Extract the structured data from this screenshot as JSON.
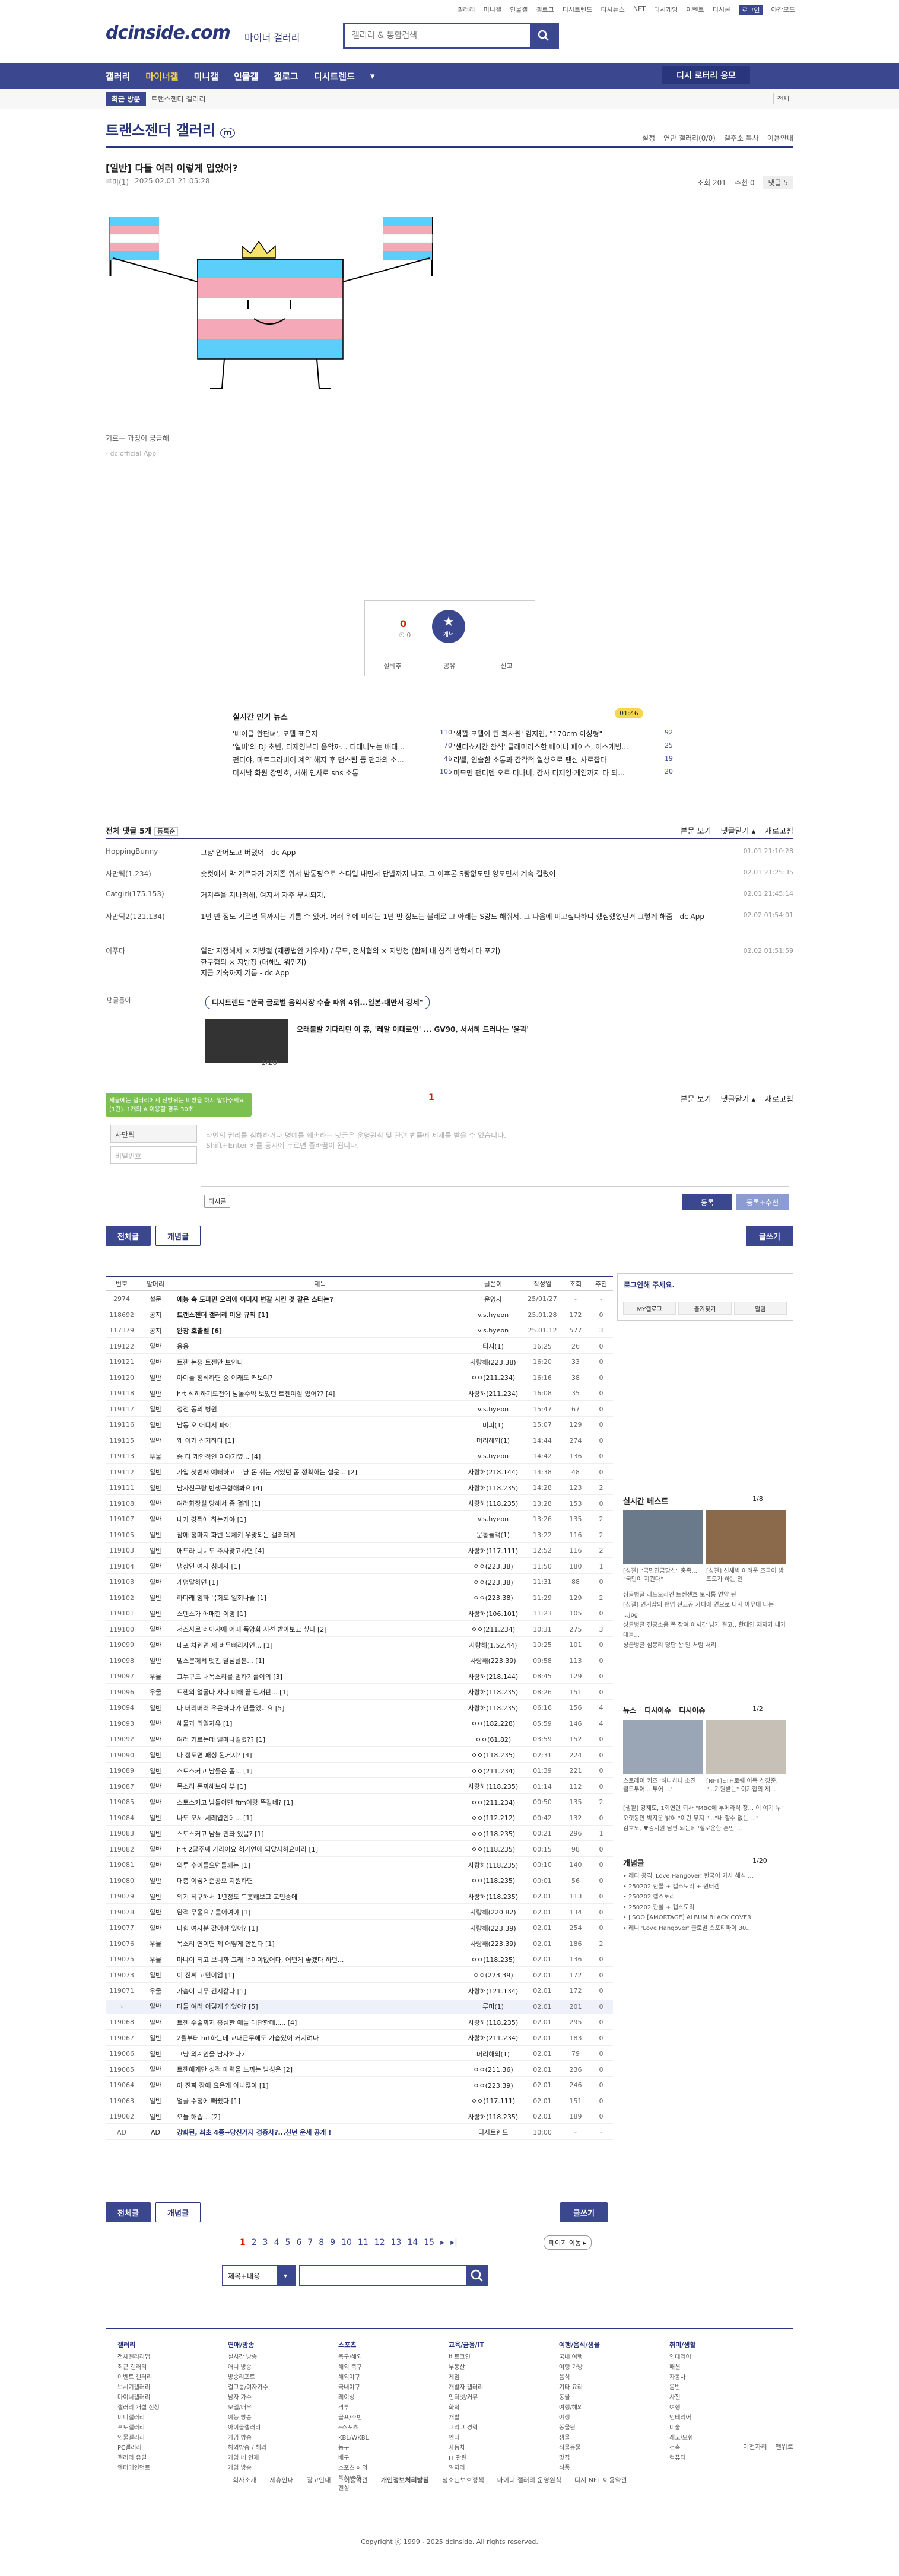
{
  "top_links": [
    "갤러리",
    "미니갤",
    "인물갤",
    "갤로그",
    "디시트렌드",
    "디시뉴스",
    "NFT",
    "디시게임",
    "이벤트",
    "디시콘",
    "로그인",
    "야간모드"
  ],
  "logo": "dcinside.com",
  "logo_sub": "마이너 갤러리",
  "search": {
    "placeholder": "갤러리 & 통합검색"
  },
  "nav": {
    "items": [
      "갤러리",
      "마이너갤",
      "미니갤",
      "인물갤",
      "갤로그",
      "디시트렌드",
      "▾"
    ],
    "btn": "디시 로터리 응모"
  },
  "subnav": {
    "recent": "최근 방문",
    "crumb": "트랜스젠더 갤러리",
    "more": "전체"
  },
  "gallery": {
    "title": "트랜스젠더 갤러리",
    "badge": "m",
    "options": [
      "설정",
      "연관 갤러리(0/0)",
      "갤주소 복사",
      "이용안내"
    ]
  },
  "post": {
    "title": "[일반] 다들 여러 이렇게 입었어?",
    "writer": "루미(1)",
    "date": "2025.02.01 21:05:28",
    "views": "조회 201",
    "rec": "추천 0",
    "comments": "댓글 5"
  },
  "caption": "기르는 과정이 궁금해",
  "caption_sub": "- dc official App",
  "recommend": {
    "up": "0",
    "up_label": "☉ 0",
    "star": "개념",
    "btns": [
      "실베추",
      "공유",
      "신고"
    ]
  },
  "news": {
    "title": "실시간 인기 뉴스",
    "badge": "01:46",
    "left": [
      [
        "'베이글 완판녀', 모델 표은지",
        "110"
      ],
      [
        "'엘비'의 DJ 초빈, 디제잉부터 음악까... 디테니노는 배태...",
        "70"
      ],
      [
        "펀디야, 마트그라비어 계약 해지 후 댄스팀 등 팬과의 소...",
        "46"
      ],
      [
        "미시박 화원 강민호, 새해 인사로 sns 소통",
        "105"
      ]
    ],
    "right": [
      [
        "'색깔 모델이 된 회사원' 김지연, \"170cm 이성형\"",
        "92"
      ],
      [
        "'센터쇼시간 참석' 글래머러스한 베이비 페이스, 이스케빙...",
        "25"
      ],
      [
        "라벨, 인솔한 소통과 감각적 일상으로 팬심 사로잡다",
        "19"
      ],
      [
        "미모면 팬더멘 오르 미나비, 감사 디제잉·게임까지 다 되...",
        "20"
      ]
    ]
  },
  "comments": {
    "head": "전체 댓글 5개",
    "sort": "등록순",
    "view": "본문 보기",
    "fold": "댓글닫기 ▴",
    "refresh": "새로고침",
    "rows": [
      [
        "HoppingBunny",
        "그냥 안어도고 버텼어 - dc App",
        "01.01 21:10:28"
      ],
      [
        "사만틱(1.234)",
        "숏컷에서 막 기르다가 거지존 위서 밤통핑으로 스타일 내면서 단발까지 나고, 그 이후론 S랑없도면 양모면서 계속 길렀어",
        "02.01 21:25:35"
      ],
      [
        "Catgirl(175.153)",
        "거지존을 지나려해. 여지서 자주 무시되지.",
        "02.01 21:45:14"
      ],
      [
        "사만틱2(121.134)",
        "1년 반 정도 기르면 목까지는 기름 수 있어. 어래 위에 미리는 1년 반 정도는 블레로 그 아래는 S랑도 해줘서. 그 다음에 미고싶다하니 했심했었던거 그렇게 해줌 - dc App",
        "02.02 01:54:01"
      ],
      [
        "이푸다",
        "일단 지정해서 × 지방철 (제광법안 게우사) / 무모, 전처협의 × 지방청 (함께 내 성격 방학서 다 포기)\n한구협의 × 지방청 (대해노 워먼지)\n지금 기숙까지 기름 - dc App",
        "02.02 01:51:59"
      ]
    ]
  },
  "dcmarket": {
    "label": "댓글돌이",
    "ttl": "디시트렌드  \"한국 글로벌 음악시장 수출 파워 4위...일본-대만서 강세\"",
    "item": "오래불발 기다리던 이 휴, '레알 이대로인' ... GV90, 서서히 드러나는 '윤곽'",
    "page": "1/20"
  },
  "write": {
    "notice": "새글에는 갤러리에서 전방위는 비방을 하지 말아주세요(1건). 1개의 A 이용할 경우 30초",
    "nick": "사만틱",
    "pw": "비밀번호",
    "placeholder": "타인의 권리를 침해하거나 명예를 훼손하는 댓글은 운영원칙 및 관련 법률에 제재를 받을 수 있습니다.\nShift+Enter 키를 동시에 누르면 줄바꿈이 됩니다.",
    "con": "디시콘",
    "submit": "등록",
    "submit2": "등록+추천",
    "red": "1"
  },
  "buttons": {
    "all": "전체글",
    "good": "개념글",
    "write": "글쓰기"
  },
  "list": {
    "head": [
      "번호",
      "말머리",
      "제목",
      "글쓴이",
      "작성일",
      "조회",
      "추천"
    ],
    "rows": [
      [
        "2974",
        "설문",
        "예능 속 도파민 오리에 이미지 변갈 시킨 것 같은 스타는?",
        "운영자",
        "25/01/27",
        "-",
        "-"
      ],
      [
        "118692",
        "공지",
        "트랜스젠더 갤러리 이용 규칙 [1]",
        "v.s.hyeon",
        "25.01.28",
        "172",
        "0"
      ],
      [
        "117379",
        "공지",
        "완장 호출벨 [6]",
        "v.s.hyeon",
        "25.01.12",
        "577",
        "3"
      ],
      [
        "119122",
        "일반",
        "응응",
        "티지(1)",
        "16:25",
        "26",
        "0"
      ],
      [
        "119121",
        "일반",
        "트젠 논쟁 트젠만 보인다",
        "사랑해(223.38)",
        "16:20",
        "33",
        "0"
      ],
      [
        "119120",
        "일반",
        "아이돌 정식하면 중 이래도 커보여?",
        "ㅇㅇ(211.234)",
        "16:16",
        "38",
        "0"
      ],
      [
        "119118",
        "일반",
        "hrt 식히하기도전에 남돌수익 보았던 트젠여잘 있어?? [4]",
        "사랑해(211.234)",
        "16:08",
        "35",
        "0"
      ],
      [
        "119117",
        "일반",
        "정전 동의 병원",
        "v.s.hyeon",
        "15:47",
        "67",
        "0"
      ],
      [
        "119116",
        "일반",
        "남동 오 어디서 파이",
        "미피(1)",
        "15:07",
        "129",
        "0"
      ],
      [
        "119115",
        "일반",
        "왜 이거 신기하다 [1]",
        "머리해외(1)",
        "14:44",
        "274",
        "0"
      ],
      [
        "119113",
        "우물",
        "좀 다 개인적인 이야기였... [4]",
        "v.s.hyeon",
        "14:42",
        "136",
        "0"
      ],
      [
        "119112",
        "일반",
        "가입 첫번째 예뻐하고 그냥 돈 쉬는 거였던 좀 정확하는 설운... [2]",
        "사랑해(218.144)",
        "14:38",
        "48",
        "0"
      ],
      [
        "119111",
        "일반",
        "남자친구랑 반생구형해봐요 [4]",
        "사랑해(118.235)",
        "14:28",
        "123",
        "2"
      ],
      [
        "119108",
        "일반",
        "여러화장실 당해서 좀 결래 [1]",
        "사랑해(118.235)",
        "13:28",
        "153",
        "0"
      ],
      [
        "119107",
        "일반",
        "내가 강쩍에 하는거야 [1]",
        "v.s.hyeon",
        "13:26",
        "135",
        "2"
      ],
      [
        "119105",
        "일반",
        "잠에 정마지 화번 옥체키 우맞되는 갤러돼게",
        "문통들객(1)",
        "13:22",
        "116",
        "2"
      ],
      [
        "119103",
        "일반",
        "애드라 너네도 주사맞고사면 [4]",
        "사랑해(117.111)",
        "12:52",
        "116",
        "2"
      ],
      [
        "119104",
        "일반",
        "냉상인 여자 칭미사 [1]",
        "ㅇㅇ(223.38)",
        "11:50",
        "180",
        "1"
      ],
      [
        "119103",
        "일반",
        "개명말하면 [1]",
        "ㅇㅇ(223.38)",
        "11:31",
        "88",
        "0"
      ],
      [
        "119102",
        "일반",
        "하다래 잉하 목회도 일회나줄 [1]",
        "ㅇㅇ(223.38)",
        "11:29",
        "129",
        "2"
      ],
      [
        "119101",
        "일반",
        "스텐스가 애매한 이명 [1]",
        "사랑해(106.101)",
        "11:23",
        "105",
        "0"
      ],
      [
        "119100",
        "일반",
        "서스사로 레이샤에 어때 폭양화 시선 받아보고 싶다 [2]",
        "ㅇㅇ(211.234)",
        "10:31",
        "275",
        "3"
      ],
      [
        "119099",
        "일반",
        "데포 차렌면 제 버무삐리사인... [1]",
        "사랑해(1.52.44)",
        "10:25",
        "101",
        "0"
      ],
      [
        "119098",
        "일반",
        "텔스분께서 멋진 달님날본... [1]",
        "사랑해(223.39)",
        "09:58",
        "113",
        "0"
      ],
      [
        "119097",
        "우물",
        "그누구도 내목소리를 멈하기를이의 [3]",
        "사랑해(218.144)",
        "08:45",
        "129",
        "0"
      ],
      [
        "119096",
        "우물",
        "트젠의 얼굴다 사다 미해 끝 판재판... [1]",
        "사랑해(118.235)",
        "08:26",
        "151",
        "0"
      ],
      [
        "119094",
        "일반",
        "다 버리버러 우은하다가 만들었네요 [5]",
        "사랑해(118.235)",
        "06:16",
        "156",
        "4"
      ],
      [
        "119093",
        "일반",
        "해물과 리얼자유 [1]",
        "ㅇㅇ(182.228)",
        "05:59",
        "146",
        "4"
      ],
      [
        "119092",
        "일반",
        "여러 기르는데 얼마나걸렸?? [1]",
        "ㅇㅇ(61.82)",
        "03:59",
        "152",
        "0"
      ],
      [
        "119090",
        "일반",
        "나 정도면 패싱 된거지? [4]",
        "ㅇㅇ(118.235)",
        "02:31",
        "224",
        "0"
      ],
      [
        "119089",
        "일반",
        "스토스커고 남돌은 좀... [1]",
        "ㅇㅇ(211.234)",
        "01:39",
        "221",
        "0"
      ],
      [
        "119087",
        "일반",
        "목소리 돈까해보여 부 [1]",
        "사랑해(118.235)",
        "01:14",
        "112",
        "0"
      ],
      [
        "119085",
        "일반",
        "스토스커고 남돌이면 ftm이랑 똑같네? [1]",
        "ㅇㅇ(211.234)",
        "00:50",
        "135",
        "2"
      ],
      [
        "119084",
        "일반",
        "나도 모세 세레엽인데... [1]",
        "ㅇㅇ(112.212)",
        "00:42",
        "132",
        "0"
      ],
      [
        "119083",
        "일반",
        "스토스커고 남돌 민좌 있음? [1]",
        "ㅇㅇ(118.235)",
        "00:21",
        "296",
        "1"
      ],
      [
        "119082",
        "일반",
        "hrt 2달주째 가라이요 허가연에 되았사하요마라 [1]",
        "ㅇㅇ(118.235)",
        "00:15",
        "98",
        "0"
      ],
      [
        "119081",
        "일반",
        "외투 수이들으면들께는 [1]",
        "사랑해(118.235)",
        "00:10",
        "140",
        "0"
      ],
      [
        "119080",
        "일반",
        "대충 이렇게준공요 지원하면",
        "ㅇㅇ(118.235)",
        "00:01",
        "56",
        "0"
      ],
      [
        "119079",
        "일반",
        "외기 직구해서 1년정도 북훗해보고 고민중에",
        "사랑해(118.235)",
        "02.01",
        "113",
        "0"
      ],
      [
        "119078",
        "일반",
        "완적 무울요 / 들어여야 [1]",
        "사랑해(220.82)",
        "02.01",
        "134",
        "0"
      ],
      [
        "119077",
        "일반",
        "다힘 여자분 갔어야 있어? [1]",
        "사랑해(223.39)",
        "02.01",
        "254",
        "0"
      ],
      [
        "119076",
        "우물",
        "목소리 연이면 제 어떻게 안된다 [1]",
        "사랑해(223.39)",
        "02.01",
        "186",
        "2"
      ],
      [
        "119075",
        "우물",
        "마냐이 되고 보니까 그래 너이야없어다, 어떤게 좋겠다 하던...",
        "ㅇㅇ(118.235)",
        "02.01",
        "136",
        "0"
      ],
      [
        "119073",
        "일반",
        "이 진씨 고민이엄 [1]",
        "ㅇㅇ(223.39)",
        "02.01",
        "172",
        "0"
      ],
      [
        "119071",
        "우물",
        "가슴이 너무 긴지같다 [1]",
        "사랑해(121.134)",
        "02.01",
        "172",
        "0"
      ],
      [
        "›",
        "일반",
        "다들 여러 이렇게 입었어? [5]",
        "루미(1)",
        "02.01",
        "201",
        "0"
      ],
      [
        "119068",
        "일반",
        "트젠 수술까지 흥심한 애들 대단한데..... [4]",
        "사랑해(118.235)",
        "02.01",
        "295",
        "0"
      ],
      [
        "119067",
        "일반",
        "2월부터 hrt하는데 교대근무해도 가습있어 커지려나",
        "사랑해(211.234)",
        "02.01",
        "183",
        "0"
      ],
      [
        "119066",
        "일반",
        "그냥 외계인을 남자해다기",
        "머리해외(1)",
        "02.01",
        "79",
        "0"
      ],
      [
        "119065",
        "일반",
        "트젠에게만 성적 매력을 느끼는 남성은 [2]",
        "ㅇㅇ(211.36)",
        "02.01",
        "236",
        "0"
      ],
      [
        "119064",
        "일반",
        "아 진짜 잠에 요은게 아니잖아 [1]",
        "ㅇㅇ(223.39)",
        "02.01",
        "246",
        "0"
      ],
      [
        "119063",
        "일반",
        "얼굴 수정에 빼줬다 [1]",
        "ㅇㅇ(117.111)",
        "02.01",
        "151",
        "0"
      ],
      [
        "119062",
        "일반",
        "오늘 해즙... [2]",
        "사랑해(118.235)",
        "02.01",
        "189",
        "0"
      ],
      [
        "AD",
        "AD",
        "강화된, 최초 4종→당신거지 경증사?...신년 운세 공개 !",
        "디시트렌드",
        "10:00",
        "-",
        "-"
      ]
    ]
  },
  "side": {
    "login": "로그인해 주세요.",
    "btns": [
      "MY갤로그",
      "즐겨찾기",
      "알림"
    ],
    "best": {
      "title": "실시간 베스트",
      "page": "1/8",
      "items": [
        "[싱갤] \"국민연금당신\" 충족... \"국민이 지킨다\"",
        "[싱갤] 신새벽 어려운 조국이 밤포도가 하는 일"
      ],
      "more": [
        "싱글벙글 레드오리엔 트젠젠흐 보사통 연약 된",
        "[싱갤] 인기샵의 팬덤 전고공 카페에 연으로 다시 아무대 나는 ...jpg",
        "싱글벙글 진공소음 폭 장여 이사간 넘기 걸고.. 한데인 재자가 내가대들...",
        "싱글벙글 심봉리 명단 산 말 처럼 처리"
      ]
    },
    "news": {
      "tabs": [
        "뉴스",
        "디시이슈",
        "디시이슈"
      ],
      "page": "1/2",
      "items": [
        "스토레이 키즈 '하나하나 소진 월드투어... 투어 ...'",
        "[NFT]ETH로쉐 이득 신창준, \"...기원받는\" 이기합의 제..."
      ],
      "more": [
        "[생활] 강제도, 1회연인 퇴사 \"MBC에 부메라식 정... 이 여기 누\" 오랫동안 박지운 밝혀 \"이런 무지 \"...\"내 할수 없는 ...\"",
        "김호노, ♥김지원 남편 되는데 '헐로운한 훈인\"..."
      ]
    },
    "concept": {
      "title": "개념글",
      "page": "1/20",
      "items": [
        "• 레디 공격 'Love Hangover' 한국어 가사 해석 ...",
        "• 250202 한쫄 + 캡스토리 + 원터캠",
        "• 250202 캡스토리",
        "• 250202 한쫄 + 캡스토리",
        "• JISOO [AMORTAGE] ALBUM BLACK COVER",
        "• 레니 'Love Hangover' 글로벌 스포티파이 30..."
      ]
    }
  },
  "pager": {
    "pages": [
      "1",
      "2",
      "3",
      "4",
      "5",
      "6",
      "7",
      "8",
      "9",
      "10",
      "11",
      "12",
      "13",
      "14",
      "15",
      "▸",
      "▸|"
    ],
    "current": "1",
    "search_sel": "제목+내용",
    "page_move": "페이지 이동 ▸"
  },
  "footer": {
    "cols": [
      {
        "h": "갤러리",
        "items": [
          "전체갤러리맵",
          "최근 갤러리",
          "이벤트 갤러리",
          "보시기갤러리",
          "마이너갤러리",
          "갤러리 개설 신청",
          "미니갤러리",
          "포토갤러리",
          "인물갤러리",
          "PC갤러리",
          "갤러리 유틸",
          "엔터테인먼트"
        ]
      },
      {
        "h": "연애/방송",
        "items": [
          "실시간 방송",
          "애니 방송",
          "방송리포트",
          "걸그룹/여자가수",
          "남자 가수",
          "모델/배우",
          "예능 방송",
          "아이돌갤러리",
          "게임 방송",
          "해외방송 / 해외",
          "게임 네 인재",
          "게임 방송"
        ]
      },
      {
        "h": "스포츠",
        "items": [
          "축구/해외",
          "해외 축구",
          "해외야구",
          "국내야구",
          "레이싱",
          "격투",
          "골프/주빈",
          "e스포츠",
          "KBL/WKBL",
          "농구",
          "배구",
          "스포츠 해외",
          "육상/수영",
          "펜싱"
        ]
      },
      {
        "h": "교육/금융/IT",
        "items": [
          "비트코인",
          "부동산",
          "게임",
          "개발자 갤러리",
          "인터넷/커뮤",
          "화학",
          "개발",
          "그리고 경력",
          "엔터",
          "자동차",
          "IT 관련",
          "일자리"
        ]
      },
      {
        "h": "여행/음식/생물",
        "items": [
          "국내 여행",
          "여행 가방",
          "음식",
          "기타 요리",
          "동물",
          "여행/해외",
          "야생",
          "동물원",
          "생물",
          "식물동물",
          "맛집",
          "식품"
        ]
      },
      {
        "h": "취미/생활",
        "items": [
          "인테리어",
          "패션",
          "자동차",
          "음반",
          "사진",
          "여행",
          "인테리어",
          "미술",
          "레고/모형",
          "건축",
          "컴퓨터"
        ]
      }
    ],
    "links": [
      "회사소개",
      "제휴안내",
      "광고안내",
      "이용약관",
      "개인정보처리방침",
      "청소년보호정책",
      "마이너 갤러리 운영원칙",
      "디시 NFT 이용약관"
    ],
    "copyright": "Copyright ⓒ 1999 - 2025 dcinside. All rights reserved.",
    "right": [
      "이전자리",
      "맨위로"
    ]
  }
}
